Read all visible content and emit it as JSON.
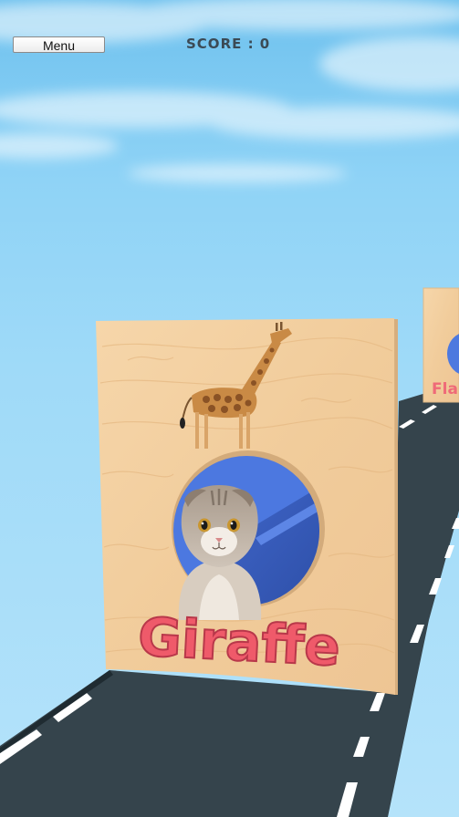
{
  "hud": {
    "menu_label": "Menu",
    "score_label": "SCORE : 0"
  },
  "gate_main": {
    "animal_name": "Giraffe",
    "top_image": "giraffe",
    "hole_image": "cat"
  },
  "gate_next": {
    "animal_name_partial": "Flar"
  },
  "colors": {
    "sky_top": "#6ec1ee",
    "sky_bottom": "#b5e3fa",
    "wood": "#f2cfa0",
    "hole_blue": "#4c78e0",
    "name_red": "#ef5a6a",
    "road": "#34444d",
    "road_edge": "#ffffff"
  }
}
